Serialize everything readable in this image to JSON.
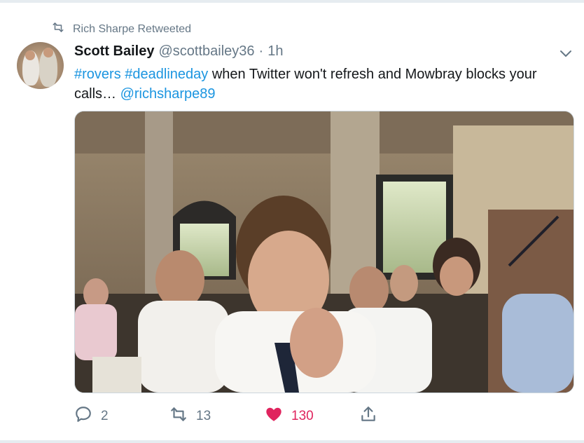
{
  "retweet_context": {
    "label": "Rich Sharpe Retweeted"
  },
  "tweet": {
    "author_name": "Scott Bailey",
    "author_handle": "@scottbailey36",
    "separator": "·",
    "time": "1h",
    "text_parts": [
      {
        "text": "#rovers",
        "kind": "hashtag"
      },
      {
        "text": " ",
        "kind": "plain"
      },
      {
        "text": "#deadlineday",
        "kind": "hashtag"
      },
      {
        "text": " when Twitter won't refresh and Mowbray blocks your calls… ",
        "kind": "plain"
      },
      {
        "text": "@richsharpe89",
        "kind": "mention"
      }
    ]
  },
  "actions": {
    "reply_count": "2",
    "retweet_count": "13",
    "like_count": "130"
  },
  "colors": {
    "link": "#1b95e0",
    "muted": "#657786",
    "like": "#e0245e",
    "divider": "#e6ecf0"
  },
  "icons": [
    "retweet-icon",
    "chevron-down-icon",
    "reply-icon",
    "heart-icon",
    "share-icon"
  ]
}
